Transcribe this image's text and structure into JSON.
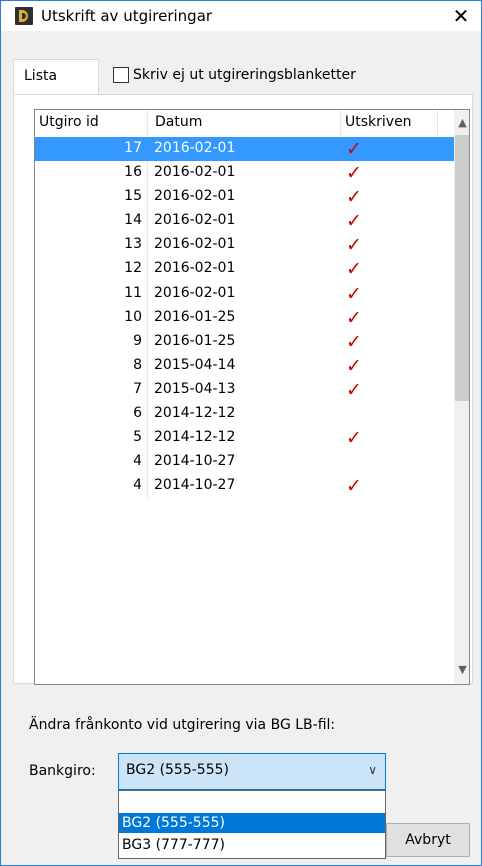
{
  "window": {
    "title": "Utskrift av utgireringar",
    "close_glyph": "✕"
  },
  "tabs": {
    "active_label": "Lista"
  },
  "checkbox": {
    "label": "Skriv ej ut utgireringsblanketter",
    "checked": false
  },
  "list": {
    "columns": [
      "Utgiro id",
      "Datum",
      "Utskriven"
    ],
    "rows": [
      {
        "id": "17",
        "date": "2016-02-01",
        "printed": "✓",
        "selected": true
      },
      {
        "id": "16",
        "date": "2016-02-01",
        "printed": "✓"
      },
      {
        "id": "15",
        "date": "2016-02-01",
        "printed": "✓"
      },
      {
        "id": "14",
        "date": "2016-02-01",
        "printed": "✓"
      },
      {
        "id": "13",
        "date": "2016-02-01",
        "printed": "✓"
      },
      {
        "id": "12",
        "date": "2016-02-01",
        "printed": "✓"
      },
      {
        "id": "11",
        "date": "2016-02-01",
        "printed": "✓"
      },
      {
        "id": "10",
        "date": "2016-01-25",
        "printed": "✓"
      },
      {
        "id": "9",
        "date": "2016-01-25",
        "printed": "✓"
      },
      {
        "id": "8",
        "date": "2015-04-14",
        "printed": "✓"
      },
      {
        "id": "7",
        "date": "2015-04-13",
        "printed": "✓"
      },
      {
        "id": "6",
        "date": "2014-12-12",
        "printed": ""
      },
      {
        "id": "5",
        "date": "2014-12-12",
        "printed": "✓"
      },
      {
        "id": "4",
        "date": "2014-10-27",
        "printed": ""
      },
      {
        "id": "4",
        "date": "2014-10-27",
        "printed": "✓"
      }
    ],
    "check_color": "#cc0000",
    "selection_color": "#3399ff"
  },
  "footer": {
    "section_label": "Ändra frånkonto vid utgirering via BG LB-fil:",
    "bankgiro_label": "Bankgiro:",
    "bankgiro_value": "BG2 (555-555)",
    "dropdown_options": [
      "",
      "BG2 (555-555)",
      "BG3 (777-777)"
    ],
    "cancel_label": "Avbryt"
  },
  "icons": {
    "app": "app-logo-icon",
    "close": "close-icon",
    "combo_arrow": "chevron-down-icon",
    "scroll_up": "chevron-up-icon",
    "scroll_down": "chevron-down-icon",
    "check": "checkmark-icon"
  }
}
